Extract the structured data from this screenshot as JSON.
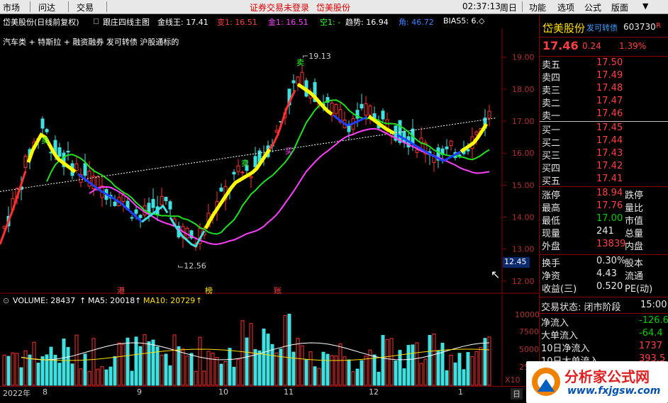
{
  "menubar": {
    "market": "市场",
    "query": "问达",
    "trade": "交易",
    "warning": "证券交易未登录",
    "stock_name": "岱美股份",
    "clock": "02:37:13",
    "weekday": "周日",
    "function": "功能",
    "options": "选项",
    "formula": "公式",
    "layout": "版面"
  },
  "header": {
    "stock": "岱美股份(日线前复权)",
    "indicator": "跟庄四线主图",
    "jinxian": "金线王: 17.41",
    "bian": "变1: 16.51",
    "jin": "金1: 16.51",
    "kong": "空1: -",
    "qushi": "趋势: 16.94",
    "jiao": "角: 46.72",
    "bias": "BIAS5: 6.◇"
  },
  "subtitle": "汽车类 + 特斯拉 + 融资融券 发可转债 沪股通标的",
  "labels": {
    "high": "19.13",
    "low": "12.56",
    "sell1": "卖",
    "sell2": "卖",
    "sell3": "卖",
    "buy1": "买",
    "buy2": "买",
    "tag_gang": "港",
    "tag_bang": "榜",
    "tag_zhang": "账",
    "cursor_price": "12.45"
  },
  "price_axis": [
    "19.00",
    "18.00",
    "17.00",
    "16.00",
    "15.00",
    "14.00",
    "13.00",
    "12.00"
  ],
  "volume": {
    "label": "VOLUME: 28437",
    "ma5": "MA5: 20018",
    "ma10": "MA10: 20729",
    "axis": [
      "10000",
      "7500",
      "5000",
      "2500"
    ],
    "unit": "X10"
  },
  "dates": {
    "year": "2022年",
    "m8": "8",
    "m9": "9",
    "m10": "10",
    "m11": "11",
    "m12": "12",
    "m1": "1",
    "day": "日"
  },
  "quote": {
    "name": "岱美股份",
    "badge": "发可转债",
    "code": "603730",
    "suffix": "R",
    "price": "17.46",
    "change": "0.24",
    "pct": "1.39%",
    "asks": [
      {
        "label": "卖五",
        "price": "17.50"
      },
      {
        "label": "卖四",
        "price": "17.49"
      },
      {
        "label": "卖三",
        "price": "17.48"
      },
      {
        "label": "卖二",
        "price": "17.47"
      },
      {
        "label": "卖一",
        "price": "17.46"
      }
    ],
    "bids": [
      {
        "label": "买一",
        "price": "17.45"
      },
      {
        "label": "买二",
        "price": "17.44"
      },
      {
        "label": "买三",
        "price": "17.43"
      },
      {
        "label": "买四",
        "price": "17.42"
      },
      {
        "label": "买五",
        "price": "17.41"
      }
    ],
    "stats": [
      {
        "k": "涨停",
        "v": "18.94",
        "k2": "跌停"
      },
      {
        "k": "最高",
        "v": "17.76",
        "k2": "量比"
      },
      {
        "k": "最低",
        "v": "17.00",
        "k2": "市值"
      },
      {
        "k": "现量",
        "v": "241",
        "k2": "总量"
      },
      {
        "k": "外盘",
        "v": "13839",
        "k2": "内盘"
      }
    ],
    "fin": [
      {
        "k": "换手",
        "v": "0.30%",
        "k2": "股本"
      },
      {
        "k": "净资",
        "v": "4.43",
        "k2": "流通"
      },
      {
        "k": "收益(三)",
        "v": "0.520",
        "k2": "PE(动)"
      }
    ],
    "status_label": "交易状态: 闭市阶段",
    "status_time": "15:00",
    "flows": [
      {
        "k": "净流入",
        "v": "-126.6"
      },
      {
        "k": "大单流入",
        "v": "-64.4"
      },
      {
        "k": "10日净流入",
        "v": "1737"
      },
      {
        "k": "10日大单流入",
        "v": "393.5"
      }
    ]
  },
  "watermark": {
    "cn": "分析家公式网",
    "url": "www.fxjgsw.com"
  }
}
